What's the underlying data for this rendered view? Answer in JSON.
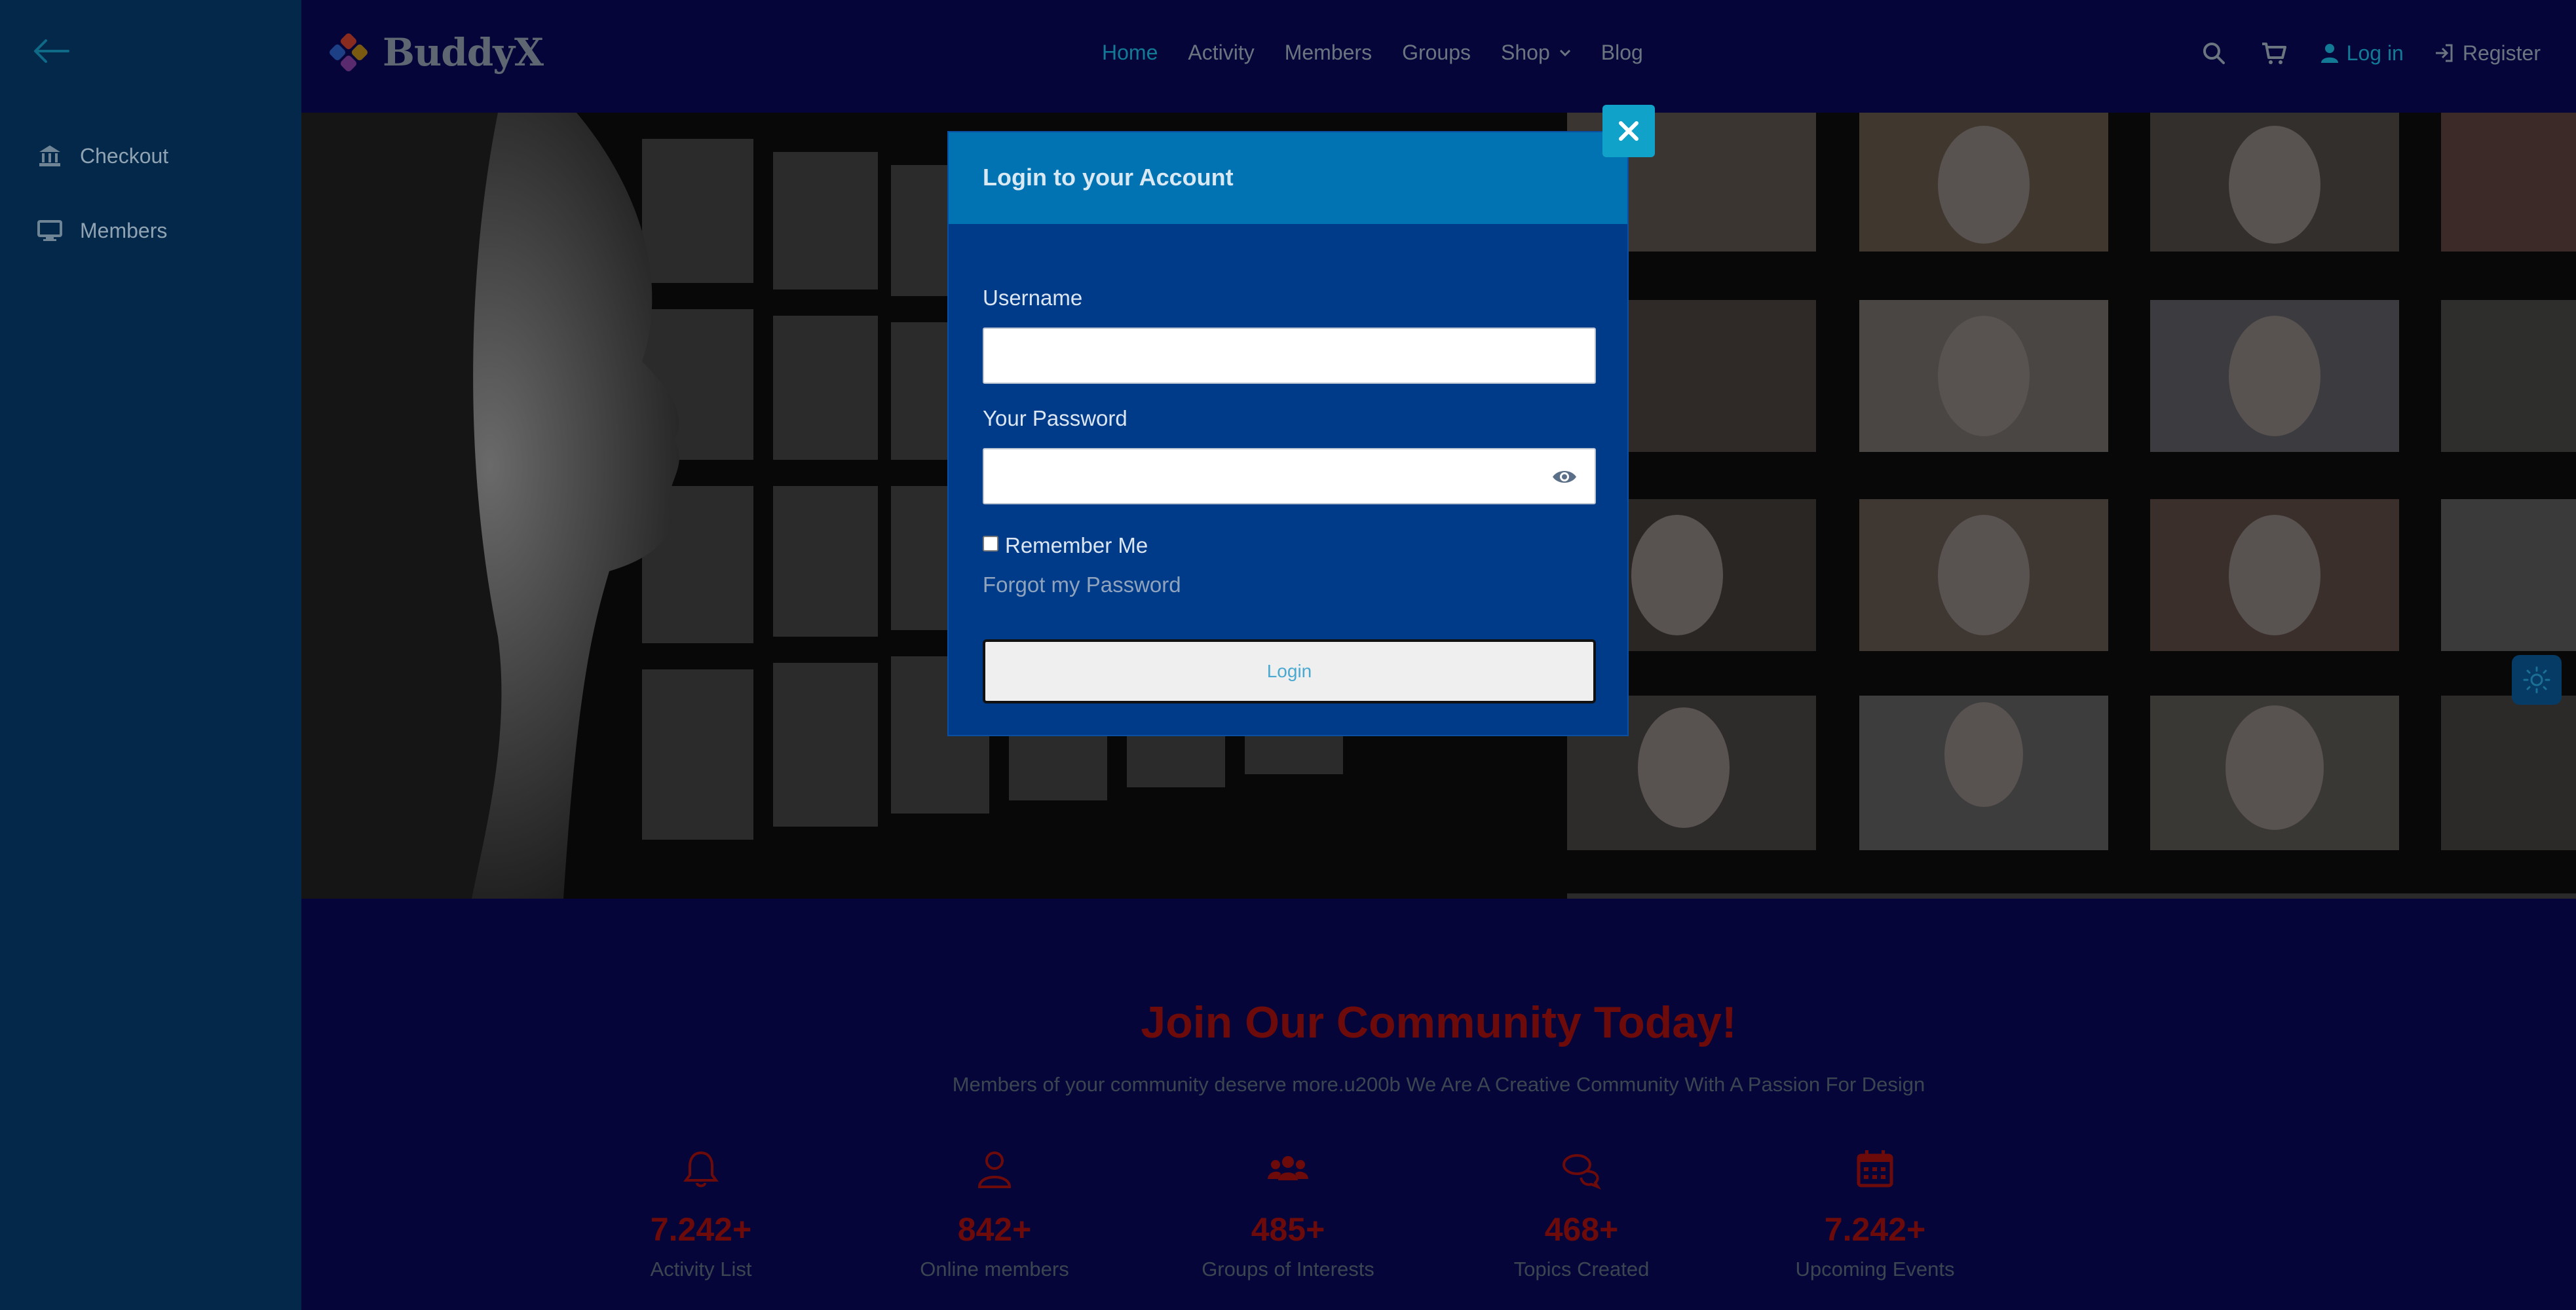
{
  "sidebar": {
    "items": [
      {
        "label": "Checkout",
        "icon": "bank-icon"
      },
      {
        "label": "Members",
        "icon": "monitor-icon"
      }
    ]
  },
  "header": {
    "logo_text": "BuddyX",
    "nav": [
      {
        "label": "Home"
      },
      {
        "label": "Activity"
      },
      {
        "label": "Members"
      },
      {
        "label": "Groups"
      },
      {
        "label": "Shop"
      },
      {
        "label": "Blog"
      }
    ],
    "login_label": "Log in",
    "register_label": "Register"
  },
  "modal": {
    "title": "Login to your Account",
    "username_label": "Username",
    "username_value": "",
    "password_label": "Your Password",
    "password_value": "",
    "remember_label": "Remember Me",
    "forgot_label": "Forgot my Password",
    "login_button": "Login"
  },
  "community": {
    "title": "Join Our Community Today!",
    "subtitle": "Members of your community deserve more.u200b We Are A Creative Community With A Passion For Design",
    "stats": [
      {
        "number": "7.242+",
        "label": "Activity List",
        "icon": "bell-icon"
      },
      {
        "number": "842+",
        "label": "Online members",
        "icon": "user-icon"
      },
      {
        "number": "485+",
        "label": "Groups of Interests",
        "icon": "users-icon"
      },
      {
        "number": "468+",
        "label": "Topics Created",
        "icon": "chat-icon"
      },
      {
        "number": "7.242+",
        "label": "Upcoming Events",
        "icon": "calendar-icon"
      }
    ]
  },
  "colors": {
    "accent": "#127a95",
    "modal_bg": "#003b8a",
    "modal_header": "#0273b2",
    "stat_red": "#6d0a0a"
  }
}
